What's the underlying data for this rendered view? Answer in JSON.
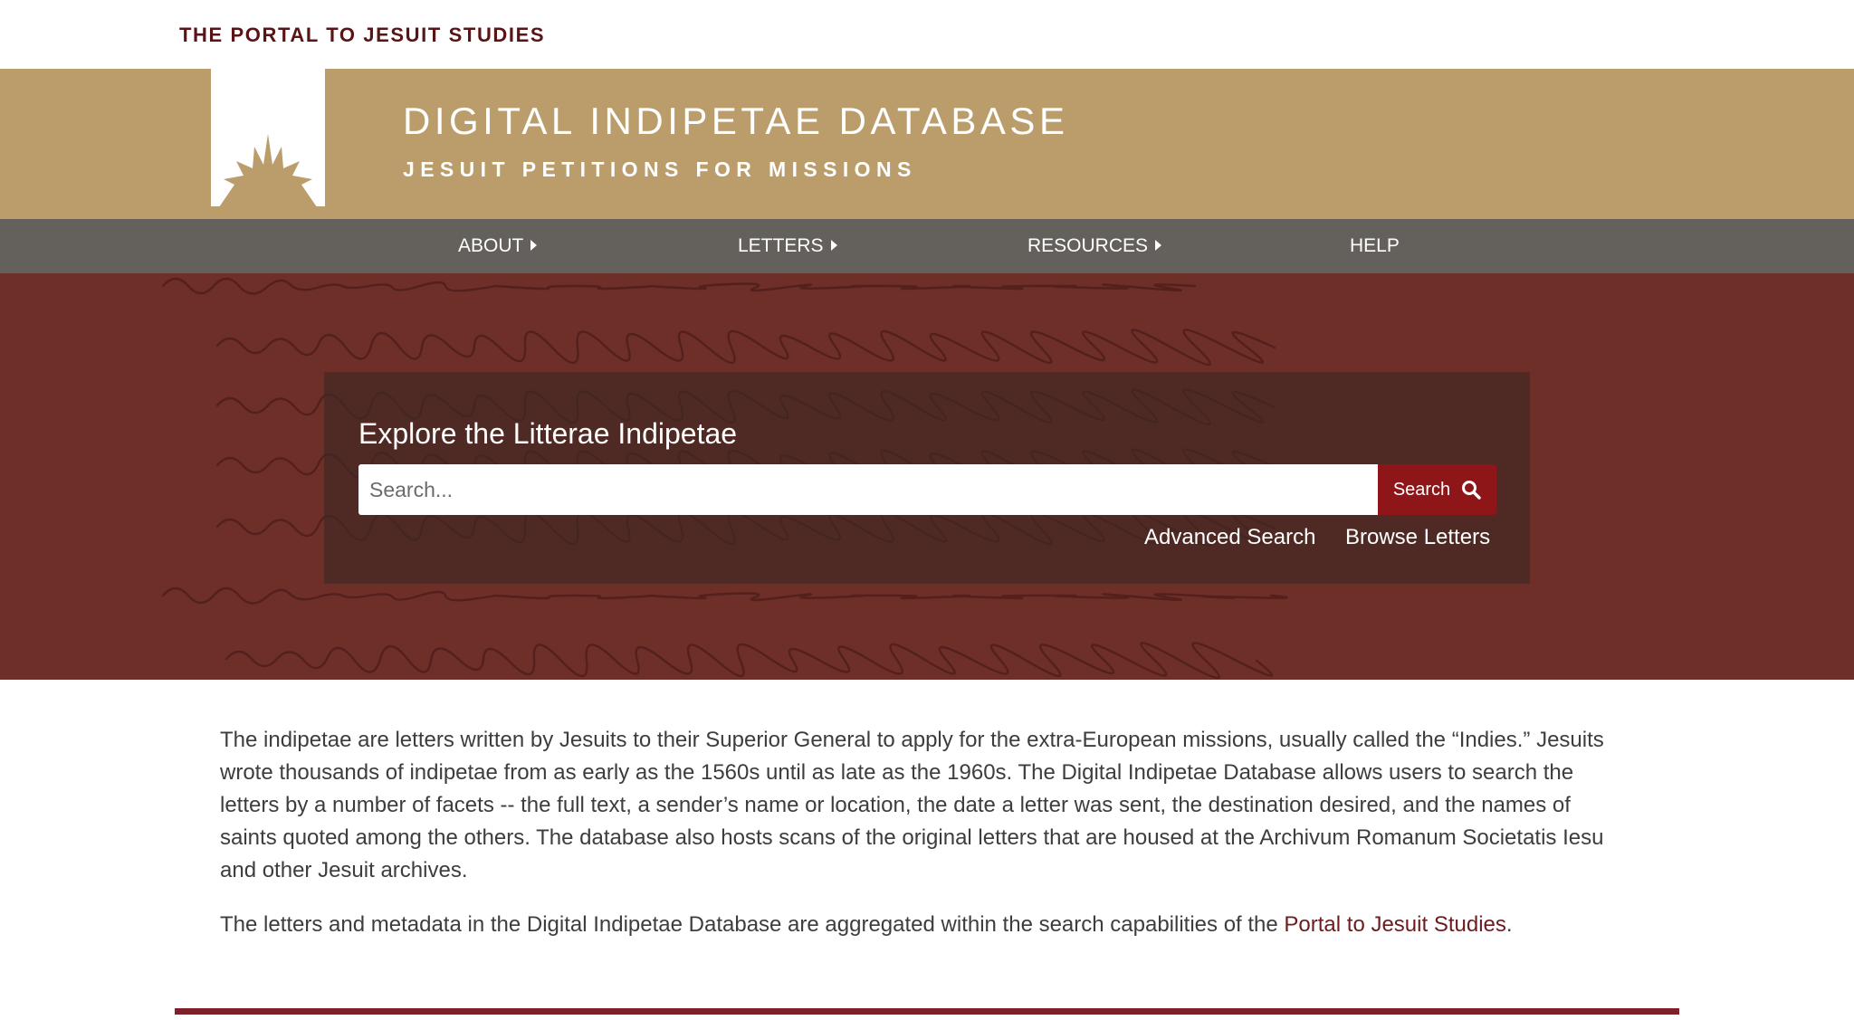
{
  "header": {
    "portal_link": "THE PORTAL TO JESUIT STUDIES",
    "title": "DIGITAL INDIPETAE DATABASE",
    "subtitle": "JESUIT PETITIONS FOR MISSIONS",
    "logo_icon": "sunburst-logo-icon"
  },
  "nav": {
    "items": [
      {
        "label": "ABOUT",
        "has_dropdown": true
      },
      {
        "label": "LETTERS",
        "has_dropdown": true
      },
      {
        "label": "RESOURCES",
        "has_dropdown": true
      },
      {
        "label": "HELP",
        "has_dropdown": false
      }
    ]
  },
  "search": {
    "title": "Explore the Litterae Indipetae",
    "placeholder": "Search...",
    "value": "",
    "button_label": "Search",
    "button_icon": "search-icon",
    "advanced_link": "Advanced Search",
    "browse_link": "Browse Letters"
  },
  "content": {
    "intro": "The indipetae are letters written by Jesuits to their Superior General to apply for the extra-European missions, usually called the “Indies.” Jesuits wrote thousands of indipetae from as early as the 1560s until as late as the 1960s. The Digital Indipetae Database allows users to search the letters by a number of facets -- the full text, a sender’s name or location, the date a letter was sent, the destination desired, and the names of saints quoted among the others. The database also hosts scans of the original letters that are housed at the Archivum Romanum Societatis Iesu and other Jesuit archives.",
    "aggregation_prefix": "The letters and metadata in the Digital Indipetae Database are aggregated within the search capabilities of the ",
    "aggregation_link": "Portal to Jesuit Studies",
    "aggregation_suffix": "."
  },
  "colors": {
    "banner": "#bb9d6b",
    "navbar": "#64605b",
    "hero": "#6e2f29",
    "accent": "#8e1518",
    "link": "#6e1c1e"
  }
}
